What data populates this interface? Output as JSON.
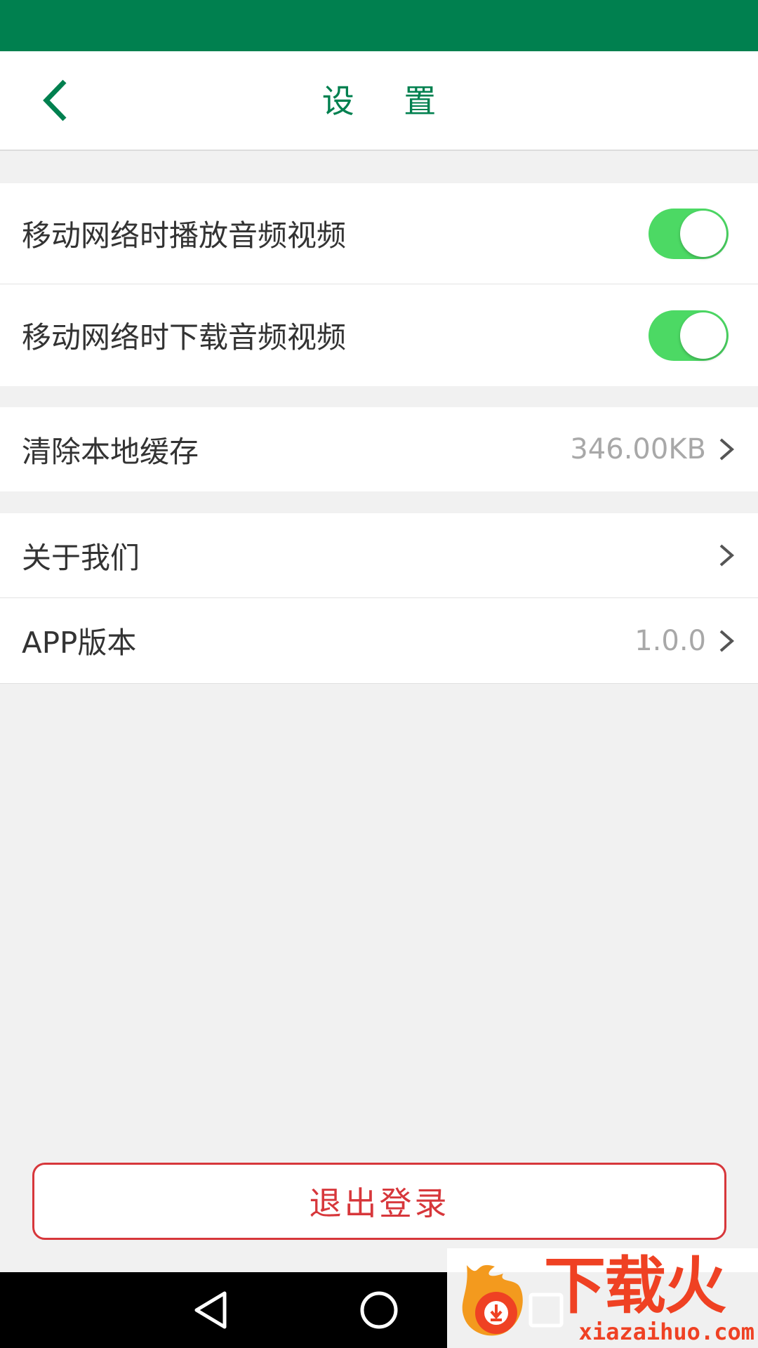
{
  "header": {
    "title": "设 置"
  },
  "sections": {
    "network": [
      {
        "label": "移动网络时播放音频视频",
        "enabled": true
      },
      {
        "label": "移动网络时下载音频视频",
        "enabled": true
      }
    ],
    "cache": {
      "label": "清除本地缓存",
      "value": "346.00KB"
    },
    "about": {
      "label": "关于我们"
    },
    "version": {
      "label": "APP版本",
      "value": "1.0.0"
    }
  },
  "logout": {
    "label": "退出登录"
  },
  "watermark": {
    "main": "下载火",
    "url": "xiazaihuo.com"
  },
  "colors": {
    "brand": "#00804f",
    "toggle_on": "#4cd964",
    "danger": "#d7373b",
    "background": "#f1f1f1"
  },
  "icons": {
    "back": "back-arrow-icon",
    "chevron": "chevron-right-icon",
    "nav": [
      "back-triangle-icon",
      "home-circle-icon",
      "recents-square-icon"
    ]
  }
}
